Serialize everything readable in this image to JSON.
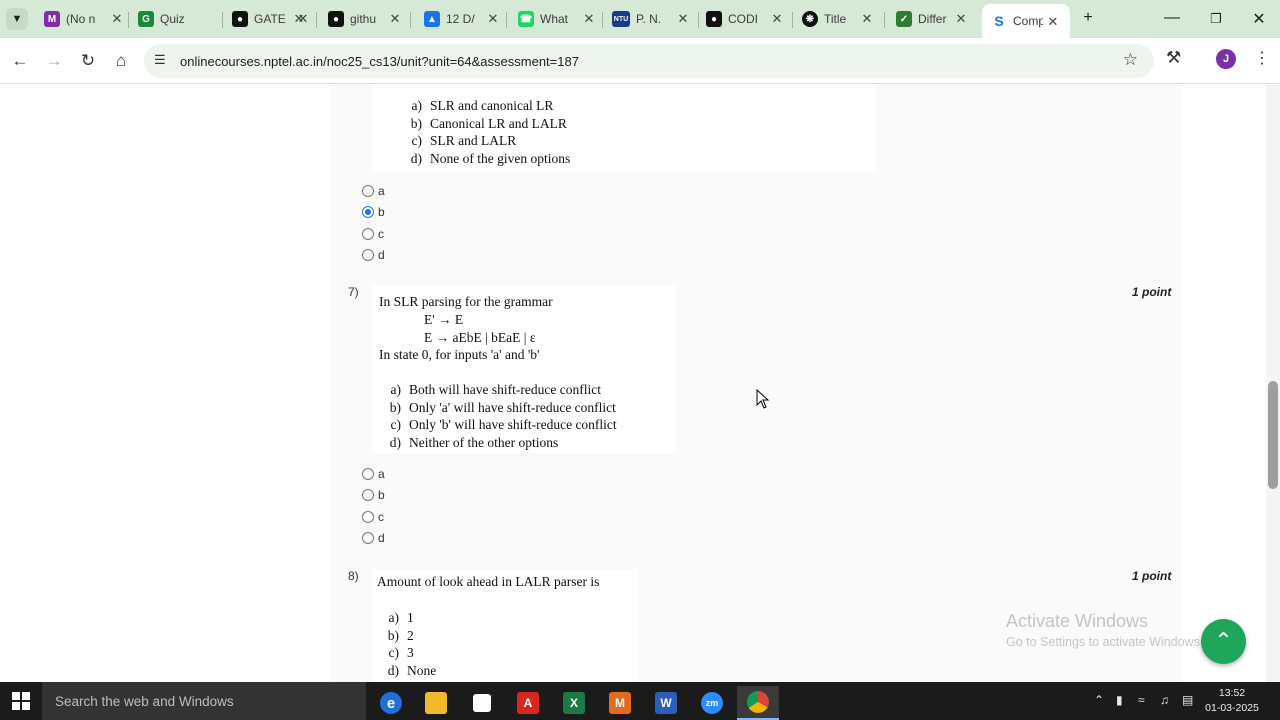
{
  "browser": {
    "tabs": [
      {
        "title": "(No n",
        "icon": "gmail-icon",
        "color": "#7b2fa8"
      },
      {
        "title": "Quiz",
        "icon": "quiz-icon",
        "color": "#1a8a3a"
      },
      {
        "title": "GATE",
        "icon": "github-icon",
        "color": "#111111"
      },
      {
        "title": "githu",
        "icon": "github-icon",
        "color": "#111111"
      },
      {
        "title": "12 D/",
        "icon": "google-drive-icon",
        "color": "#1a73e8"
      },
      {
        "title": "What",
        "icon": "whatsapp-icon",
        "color": "#25d366"
      },
      {
        "title": "P. N.",
        "icon": "ntu-icon",
        "color": "#1a3a8a"
      },
      {
        "title": "CODI",
        "icon": "github-icon",
        "color": "#111111"
      },
      {
        "title": "Title",
        "icon": "chatgpt-icon",
        "color": "#111111"
      },
      {
        "title": "Differ",
        "icon": "spread-icon",
        "color": "#2e7d32"
      },
      {
        "title": "Comp",
        "icon": "scribd-icon",
        "color": "#1a73e8"
      }
    ],
    "active_tab_index": 10,
    "url": "onlinecourses.nptel.ac.in/noc25_cs13/unit?unit=64&assessment=187",
    "profile_initial": "J"
  },
  "questions": {
    "q6": {
      "options": [
        {
          "key": "a)",
          "text": "SLR and canonical LR"
        },
        {
          "key": "b)",
          "text": "Canonical LR and LALR"
        },
        {
          "key": "c)",
          "text": "SLR and LALR"
        },
        {
          "key": "d)",
          "text": "None of the given options"
        }
      ],
      "radios": [
        "a",
        "b",
        "c",
        "d"
      ],
      "selected": "b"
    },
    "q7": {
      "number": "7)",
      "points": "1 point",
      "stem": "In SLR parsing for the grammar",
      "grammar_line1": "E' → E",
      "grammar_line2": "E → aEbE | bEaE | ε",
      "stem2": "In state 0, for inputs 'a' and 'b'",
      "options": [
        {
          "key": "a)",
          "text": "Both will have shift-reduce conflict"
        },
        {
          "key": "b)",
          "text": "Only 'a' will have shift-reduce conflict"
        },
        {
          "key": "c)",
          "text": "Only 'b' will have shift-reduce conflict"
        },
        {
          "key": "d)",
          "text": "Neither of the other options"
        }
      ],
      "radios": [
        "a",
        "b",
        "c",
        "d"
      ],
      "selected": null
    },
    "q8": {
      "number": "8)",
      "points": "1 point",
      "stem": "Amount of look ahead in LALR parser is",
      "options": [
        {
          "key": "a)",
          "text": "1"
        },
        {
          "key": "b)",
          "text": "2"
        },
        {
          "key": "c)",
          "text": "3"
        },
        {
          "key": "d)",
          "text": "None"
        }
      ]
    }
  },
  "watermark": {
    "line1": "Activate Windows",
    "line2": "Go to Settings to activate Windows."
  },
  "taskbar": {
    "search_placeholder": "Search the web and Windows",
    "apps": [
      {
        "name": "edge-icon",
        "label": "e",
        "color": "#1e6fd9"
      },
      {
        "name": "file-explorer-icon",
        "label": "",
        "color": "#f2b92a"
      },
      {
        "name": "store-icon",
        "label": "",
        "color": "#ffffff"
      },
      {
        "name": "acrobat-icon",
        "label": "A",
        "color": "#d6281e"
      },
      {
        "name": "excel-icon",
        "label": "X",
        "color": "#1d7a45"
      },
      {
        "name": "matlab-icon",
        "label": "M",
        "color": "#e36a1e"
      },
      {
        "name": "word-icon",
        "label": "W",
        "color": "#2b5eb8"
      },
      {
        "name": "zoom-icon",
        "label": "zm",
        "color": "#2d8cff"
      },
      {
        "name": "chrome-icon",
        "label": "",
        "color": "#db4437"
      }
    ],
    "time": "13:52",
    "date": "01-03-2025"
  }
}
